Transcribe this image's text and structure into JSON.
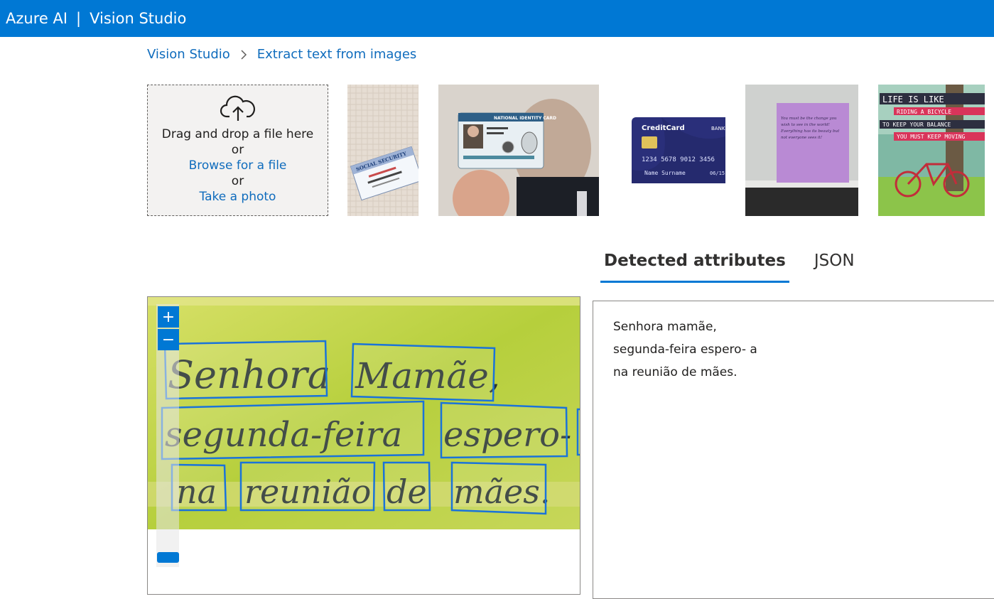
{
  "header": {
    "brand": "Azure AI",
    "separator": "|",
    "product": "Vision Studio"
  },
  "breadcrumb": {
    "root": "Vision Studio",
    "current": "Extract text from images"
  },
  "upload": {
    "drag_text": "Drag and drop a file here",
    "or1": "or",
    "browse": "Browse for a file",
    "or2": "or",
    "photo": "Take a photo"
  },
  "samples": {
    "ssn_card": "SOCIAL SECURITY",
    "id_card": "NATIONAL IDENTITY CARD",
    "credit_card": {
      "brand": "CreditCard",
      "bank": "BANK",
      "number": "1234  5678  9012  3456",
      "name": "Name Surname",
      "expiry": "06/15"
    },
    "sticky_note": "You must be the change you wish to see in the world! Everything has its beauty but not everyone sees it!",
    "poster": [
      "LIFE IS LIKE",
      "RIDING A BICYCLE",
      "TO KEEP YOUR BALANCE",
      "YOU MUST KEEP MOVING"
    ]
  },
  "tabs": {
    "detected": "Detected attributes",
    "json": "JSON"
  },
  "zoom": {
    "in": "+",
    "out": "−"
  },
  "handwriting": {
    "line1": [
      "Senhora",
      "Mamãe,"
    ],
    "line2": [
      "segunda-feira",
      "espero-"
    ],
    "line3": [
      "na",
      "reunião",
      "de",
      "mães."
    ]
  },
  "results": {
    "line1": "Senhora mamãe,",
    "line2": "segunda-feira espero- a",
    "line3": "na reunião de mães."
  },
  "colors": {
    "accent": "#0078d4",
    "link": "#0f6cbd",
    "bbox": "#1a73d9",
    "paper": "#c8d84a"
  }
}
